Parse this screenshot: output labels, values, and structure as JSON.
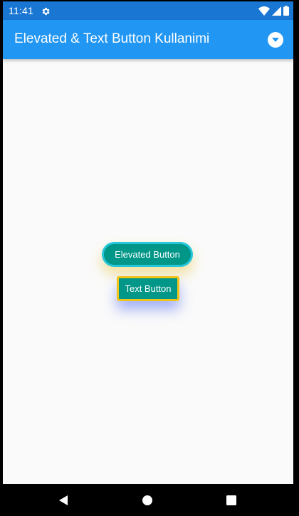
{
  "status_bar": {
    "time": "11:41",
    "background": "#1976d2",
    "icons": [
      "settings-gear-icon",
      "wifi-icon",
      "cellular-signal-icon",
      "battery-icon"
    ]
  },
  "app_bar": {
    "title": "Elevated & Text Button Kullanimi",
    "background": "#2196f3",
    "action_icon": "dropdown-circle-icon"
  },
  "buttons": {
    "elevated": {
      "label": "Elevated Button",
      "background": "#009688",
      "border_color": "#26c6da",
      "shadow_color": "#e6be28"
    },
    "text": {
      "label": "Text Button",
      "background": "#009688",
      "border_color": "#f0c419",
      "shadow_color": "#3c5af0"
    }
  },
  "nav_bar": {
    "icons": [
      "back-triangle-icon",
      "home-circle-icon",
      "recent-apps-square-icon"
    ]
  }
}
